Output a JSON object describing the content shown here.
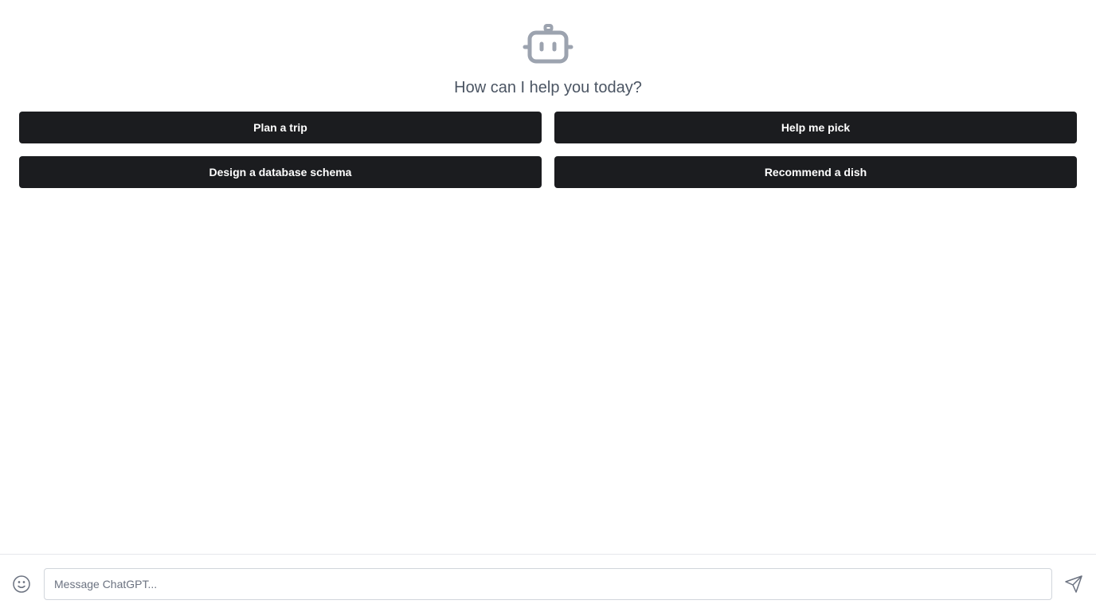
{
  "header": {
    "icon": "robot-icon",
    "greeting": "How can I help you today?"
  },
  "suggestions": [
    {
      "label": "Plan a trip"
    },
    {
      "label": "Help me pick"
    },
    {
      "label": "Design a database schema"
    },
    {
      "label": "Recommend a dish"
    }
  ],
  "composer": {
    "emoji_icon": "smiley-icon",
    "placeholder": "Message ChatGPT...",
    "value": "",
    "send_icon": "send-icon"
  },
  "colors": {
    "button_bg": "#1b1c1f",
    "button_text": "#ffffff",
    "icon_gray": "#9ca3af",
    "greeting_text": "#4b5563"
  }
}
